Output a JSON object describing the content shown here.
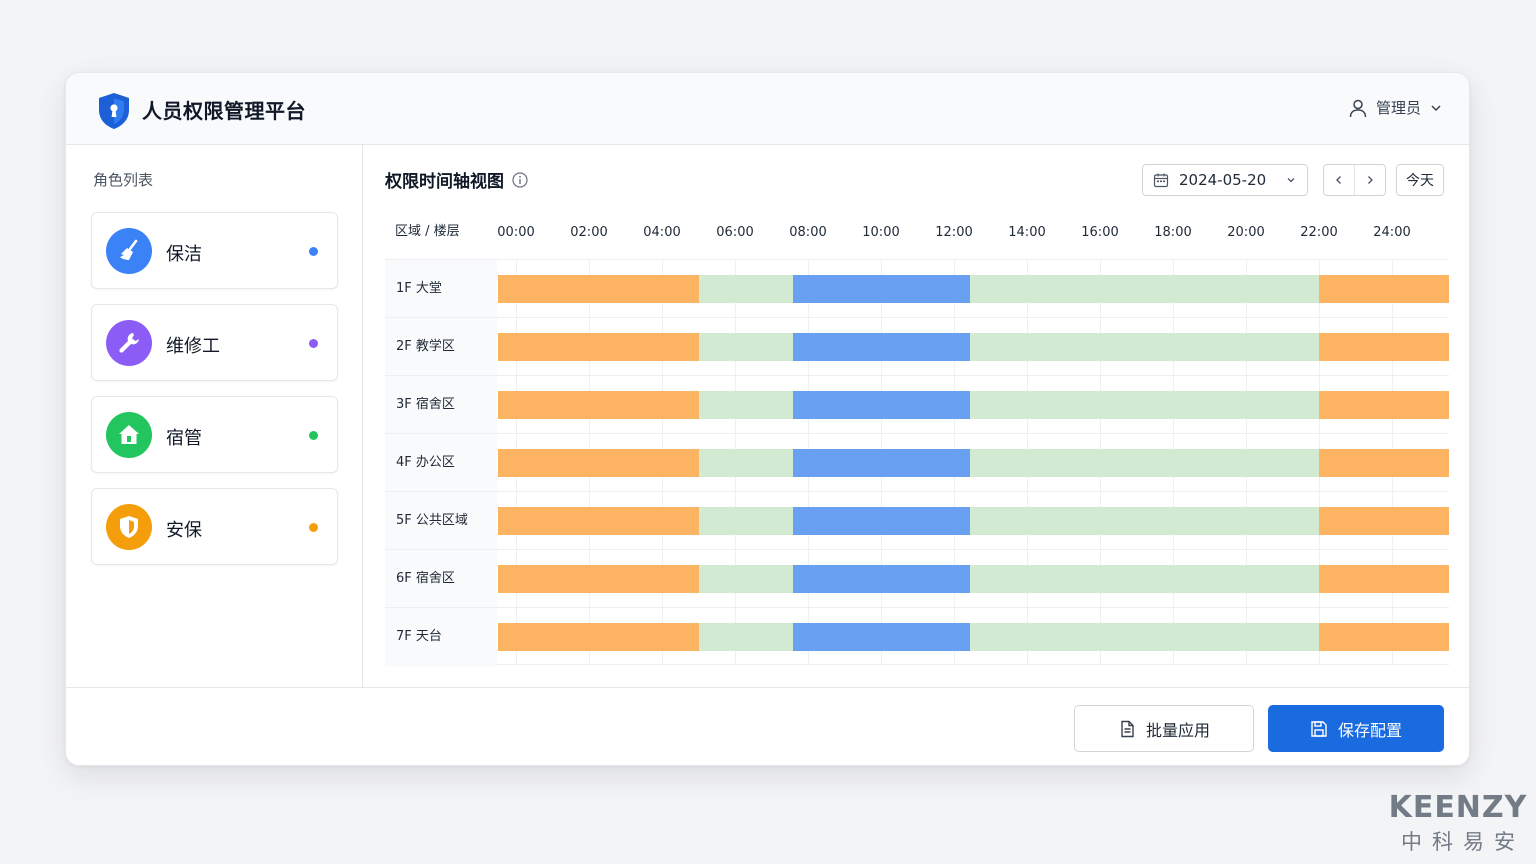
{
  "header": {
    "app_title": "人员权限管理平台",
    "user_name": "管理员"
  },
  "sidebar": {
    "title": "角色列表",
    "roles": [
      {
        "label": "保洁",
        "icon": "broom-icon",
        "color": "#3b82f6",
        "dot_color": "#3b82f6"
      },
      {
        "label": "维修工",
        "icon": "wrench-icon",
        "color": "#8b5cf6",
        "dot_color": "#8b5cf6"
      },
      {
        "label": "宿管",
        "icon": "home-icon",
        "color": "#22c55e",
        "dot_color": "#22c55e"
      },
      {
        "label": "安保",
        "icon": "shield-icon",
        "color": "#f59e0b",
        "dot_color": "#f59e0b"
      }
    ]
  },
  "main": {
    "title": "权限时间轴视图",
    "date_value": "2024-05-20",
    "today_label": "今天"
  },
  "timeline": {
    "area_header": "区域 / 楼层",
    "ticks": [
      "00:00",
      "02:00",
      "04:00",
      "06:00",
      "08:00",
      "10:00",
      "12:00",
      "14:00",
      "16:00",
      "18:00",
      "20:00",
      "22:00",
      "24:00"
    ],
    "colors": {
      "orange": "#fdb462",
      "green": "#d3ead2",
      "blue": "#6aa0f1"
    },
    "rows": [
      {
        "label": "1F 大堂"
      },
      {
        "label": "2F 教学区"
      },
      {
        "label": "3F 宿舍区"
      },
      {
        "label": "4F 办公区"
      },
      {
        "label": "5F 公共区域"
      },
      {
        "label": "6F 宿舍区"
      },
      {
        "label": "7F 天台"
      }
    ],
    "segments": [
      {
        "from": -0.5,
        "to": 5,
        "color": "orange"
      },
      {
        "from": 5,
        "to": 7.6,
        "color": "green"
      },
      {
        "from": 7.6,
        "to": 12.45,
        "color": "blue"
      },
      {
        "from": 12.45,
        "to": 22,
        "color": "green"
      },
      {
        "from": 22,
        "to": 25.6,
        "color": "orange"
      }
    ]
  },
  "footer": {
    "batch_label": "批量应用",
    "save_label": "保存配置"
  },
  "watermark": {
    "brand": "KEENZY",
    "sub": "中科易安"
  }
}
